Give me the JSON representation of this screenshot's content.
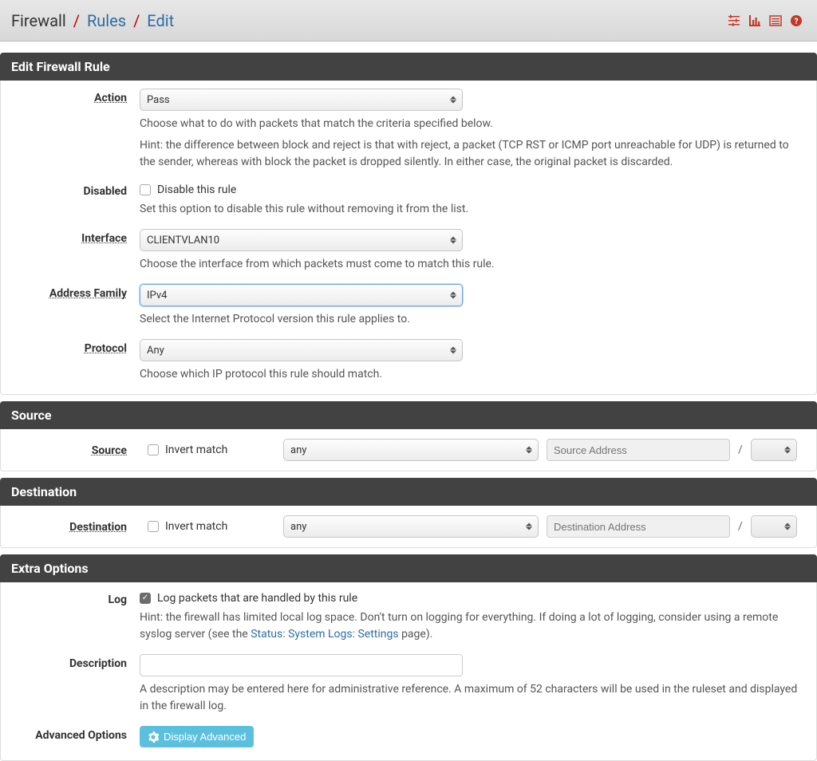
{
  "breadcrumb": {
    "root": "Firewall",
    "mid": "Rules",
    "current": "Edit"
  },
  "sections": {
    "edit": "Edit Firewall Rule",
    "source": "Source",
    "destination": "Destination",
    "extra": "Extra Options"
  },
  "action": {
    "label": "Action",
    "value": "Pass",
    "help1": "Choose what to do with packets that match the criteria specified below.",
    "help2": "Hint: the difference between block and reject is that with reject, a packet (TCP RST or ICMP port unreachable for UDP) is returned to the sender, whereas with block the packet is dropped silently. In either case, the original packet is discarded."
  },
  "disabled": {
    "label": "Disabled",
    "checkbox_label": "Disable this rule",
    "help": "Set this option to disable this rule without removing it from the list."
  },
  "interface": {
    "label": "Interface",
    "value": "CLIENTVLAN10",
    "help": "Choose the interface from which packets must come to match this rule."
  },
  "address_family": {
    "label": "Address Family",
    "value": "IPv4",
    "help": "Select the Internet Protocol version this rule applies to."
  },
  "protocol": {
    "label": "Protocol",
    "value": "Any",
    "help": "Choose which IP protocol this rule should match."
  },
  "source": {
    "label": "Source",
    "invert_label": "Invert match",
    "type_value": "any",
    "addr_placeholder": "Source Address",
    "slash": "/"
  },
  "destination": {
    "label": "Destination",
    "invert_label": "Invert match",
    "type_value": "any",
    "addr_placeholder": "Destination Address",
    "slash": "/"
  },
  "log": {
    "label": "Log",
    "checkbox_label": "Log packets that are handled by this rule",
    "help_pre": "Hint: the firewall has limited local log space. Don't turn on logging for everything. If doing a lot of logging, consider using a remote syslog server (see the ",
    "help_link": "Status: System Logs: Settings",
    "help_post": " page)."
  },
  "description": {
    "label": "Description",
    "value": "",
    "help": "A description may be entered here for administrative reference. A maximum of 52 characters will be used in the ruleset and displayed in the firewall log."
  },
  "advanced": {
    "label": "Advanced Options",
    "button": "Display Advanced"
  }
}
